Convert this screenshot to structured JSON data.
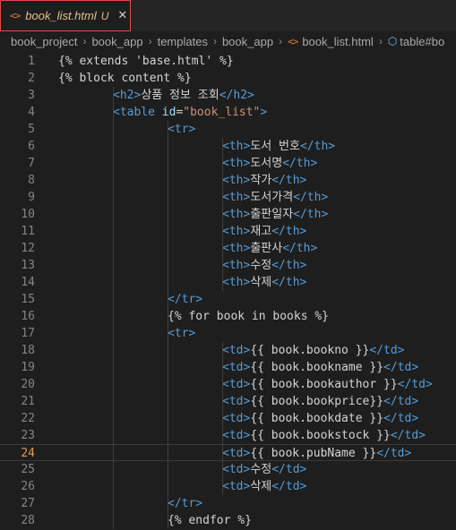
{
  "tab": {
    "icon": "<>",
    "filename": "book_list.html",
    "status": "U",
    "close": "✕"
  },
  "breadcrumbs": {
    "items": [
      "book_project",
      "book_app",
      "templates",
      "book_app"
    ],
    "file_icon": "<>",
    "file": "book_list.html",
    "symbol_icon": "symbol-class-icon",
    "symbol": "table#bo"
  },
  "current_line": 24,
  "lines": [
    {
      "n": "1",
      "i": 0,
      "t": [
        [
          "tpl",
          "{% extends 'base.html' %}"
        ]
      ]
    },
    {
      "n": "2",
      "i": 0,
      "t": [
        [
          "tpl",
          "{% block content %}"
        ]
      ]
    },
    {
      "n": "3",
      "i": 1,
      "t": [
        [
          "tag",
          "<h2>"
        ],
        [
          "text",
          "상품 정보 조회"
        ],
        [
          "tag",
          "</h2>"
        ]
      ]
    },
    {
      "n": "4",
      "i": 1,
      "t": [
        [
          "tag",
          "<table "
        ],
        [
          "attr",
          "id"
        ],
        [
          "text",
          "="
        ],
        [
          "str",
          "\"book_list\""
        ],
        [
          "tag",
          ">"
        ]
      ]
    },
    {
      "n": "5",
      "i": 2,
      "t": [
        [
          "tag",
          "<tr>"
        ]
      ]
    },
    {
      "n": "6",
      "i": 3,
      "t": [
        [
          "tag",
          "<th>"
        ],
        [
          "text",
          "도서 번호"
        ],
        [
          "tag",
          "</th>"
        ]
      ]
    },
    {
      "n": "7",
      "i": 3,
      "t": [
        [
          "tag",
          "<th>"
        ],
        [
          "text",
          "도서명"
        ],
        [
          "tag",
          "</th>"
        ]
      ]
    },
    {
      "n": "8",
      "i": 3,
      "t": [
        [
          "tag",
          "<th>"
        ],
        [
          "text",
          "작가"
        ],
        [
          "tag",
          "</th>"
        ]
      ]
    },
    {
      "n": "9",
      "i": 3,
      "t": [
        [
          "tag",
          "<th>"
        ],
        [
          "text",
          "도서가격"
        ],
        [
          "tag",
          "</th>"
        ]
      ]
    },
    {
      "n": "10",
      "i": 3,
      "t": [
        [
          "tag",
          "<th>"
        ],
        [
          "text",
          "출판일자"
        ],
        [
          "tag",
          "</th>"
        ]
      ]
    },
    {
      "n": "11",
      "i": 3,
      "t": [
        [
          "tag",
          "<th>"
        ],
        [
          "text",
          "재고"
        ],
        [
          "tag",
          "</th>"
        ]
      ]
    },
    {
      "n": "12",
      "i": 3,
      "t": [
        [
          "tag",
          "<th>"
        ],
        [
          "text",
          "출판사"
        ],
        [
          "tag",
          "</th>"
        ]
      ]
    },
    {
      "n": "13",
      "i": 3,
      "t": [
        [
          "tag",
          "<th>"
        ],
        [
          "text",
          "수정"
        ],
        [
          "tag",
          "</th>"
        ]
      ]
    },
    {
      "n": "14",
      "i": 3,
      "t": [
        [
          "tag",
          "<th>"
        ],
        [
          "text",
          "삭제"
        ],
        [
          "tag",
          "</th>"
        ]
      ]
    },
    {
      "n": "15",
      "i": 2,
      "t": [
        [
          "tag",
          "</tr>"
        ]
      ]
    },
    {
      "n": "16",
      "i": 2,
      "t": [
        [
          "tpl",
          "{% for book in books %}"
        ]
      ]
    },
    {
      "n": "17",
      "i": 2,
      "t": [
        [
          "tag",
          "<tr>"
        ]
      ]
    },
    {
      "n": "18",
      "i": 3,
      "t": [
        [
          "tag",
          "<td>"
        ],
        [
          "tpl",
          "{{ book.bookno }}"
        ],
        [
          "tag",
          "</td>"
        ]
      ]
    },
    {
      "n": "19",
      "i": 3,
      "t": [
        [
          "tag",
          "<td>"
        ],
        [
          "tpl",
          "{{ book.bookname }}"
        ],
        [
          "tag",
          "</td>"
        ]
      ]
    },
    {
      "n": "20",
      "i": 3,
      "t": [
        [
          "tag",
          "<td>"
        ],
        [
          "tpl",
          "{{ book.bookauthor }}"
        ],
        [
          "tag",
          "</td>"
        ]
      ]
    },
    {
      "n": "21",
      "i": 3,
      "t": [
        [
          "tag",
          "<td>"
        ],
        [
          "tpl",
          "{{ book.bookprice}}"
        ],
        [
          "tag",
          "</td>"
        ]
      ]
    },
    {
      "n": "22",
      "i": 3,
      "t": [
        [
          "tag",
          "<td>"
        ],
        [
          "tpl",
          "{{ book.bookdate }}"
        ],
        [
          "tag",
          "</td>"
        ]
      ]
    },
    {
      "n": "23",
      "i": 3,
      "t": [
        [
          "tag",
          "<td>"
        ],
        [
          "tpl",
          "{{ book.bookstock }}"
        ],
        [
          "tag",
          "</td>"
        ]
      ]
    },
    {
      "n": "24",
      "i": 3,
      "t": [
        [
          "tag",
          "<td>"
        ],
        [
          "tpl",
          "{{ book.pubName }}"
        ],
        [
          "tag",
          "</td>"
        ]
      ]
    },
    {
      "n": "25",
      "i": 3,
      "t": [
        [
          "tag",
          "<td>"
        ],
        [
          "text",
          "수정"
        ],
        [
          "tag",
          "</td>"
        ]
      ]
    },
    {
      "n": "26",
      "i": 3,
      "t": [
        [
          "tag",
          "<td>"
        ],
        [
          "text",
          "삭제"
        ],
        [
          "tag",
          "</td>"
        ]
      ]
    },
    {
      "n": "27",
      "i": 2,
      "t": [
        [
          "tag",
          "</tr>"
        ]
      ]
    },
    {
      "n": "28",
      "i": 2,
      "t": [
        [
          "tpl",
          "{% endfor %}"
        ]
      ]
    }
  ]
}
